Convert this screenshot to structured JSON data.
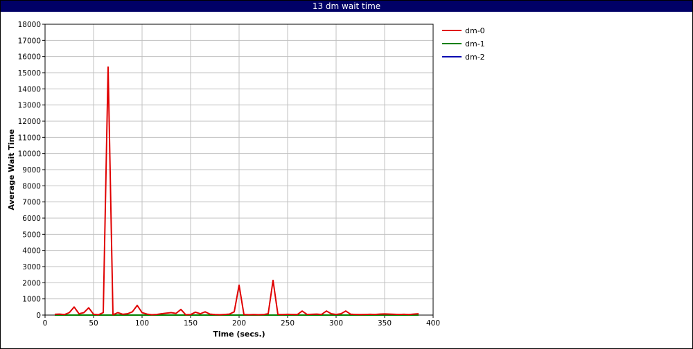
{
  "window": {
    "title": "13 dm wait time"
  },
  "chart_data": {
    "type": "line",
    "title": "13 dm wait time",
    "xlabel": "Time (secs.)",
    "ylabel": "Average Wait Time",
    "xlim": [
      0,
      400
    ],
    "ylim": [
      0,
      18000
    ],
    "x_ticks": [
      0,
      50,
      100,
      150,
      200,
      250,
      300,
      350,
      400
    ],
    "y_ticks": [
      0,
      1000,
      2000,
      3000,
      4000,
      5000,
      6000,
      7000,
      8000,
      9000,
      10000,
      11000,
      12000,
      13000,
      14000,
      15000,
      16000,
      17000,
      18000
    ],
    "grid": true,
    "legend_position": "right",
    "series": [
      {
        "name": "dm-0",
        "color": "#e00000",
        "x": [
          10,
          15,
          20,
          25,
          30,
          35,
          40,
          45,
          50,
          55,
          60,
          65,
          70,
          75,
          80,
          85,
          90,
          95,
          100,
          105,
          110,
          115,
          120,
          125,
          130,
          135,
          140,
          145,
          150,
          155,
          160,
          165,
          170,
          175,
          180,
          185,
          190,
          195,
          200,
          205,
          210,
          215,
          220,
          225,
          230,
          235,
          240,
          245,
          250,
          255,
          260,
          265,
          270,
          275,
          280,
          285,
          290,
          295,
          300,
          305,
          310,
          315,
          320,
          325,
          330,
          335,
          340,
          345,
          350,
          355,
          360,
          365,
          370,
          375,
          380,
          385
        ],
        "values": [
          50,
          60,
          30,
          150,
          500,
          80,
          150,
          450,
          50,
          20,
          150,
          15350,
          20,
          150,
          50,
          80,
          200,
          600,
          150,
          60,
          20,
          40,
          80,
          120,
          150,
          100,
          350,
          20,
          30,
          180,
          80,
          200,
          60,
          30,
          20,
          40,
          60,
          200,
          1850,
          30,
          20,
          30,
          20,
          30,
          80,
          2150,
          40,
          30,
          50,
          40,
          30,
          250,
          40,
          50,
          60,
          40,
          250,
          80,
          40,
          80,
          250,
          50,
          40,
          30,
          40,
          50,
          40,
          60,
          70,
          60,
          50,
          40,
          50,
          30,
          60,
          80
        ]
      },
      {
        "name": "dm-1",
        "color": "#008000",
        "x": [
          10,
          385
        ],
        "values": [
          0,
          0
        ]
      },
      {
        "name": "dm-2",
        "color": "#0000b0",
        "x": [
          10,
          385
        ],
        "values": [
          0,
          0
        ]
      }
    ]
  }
}
